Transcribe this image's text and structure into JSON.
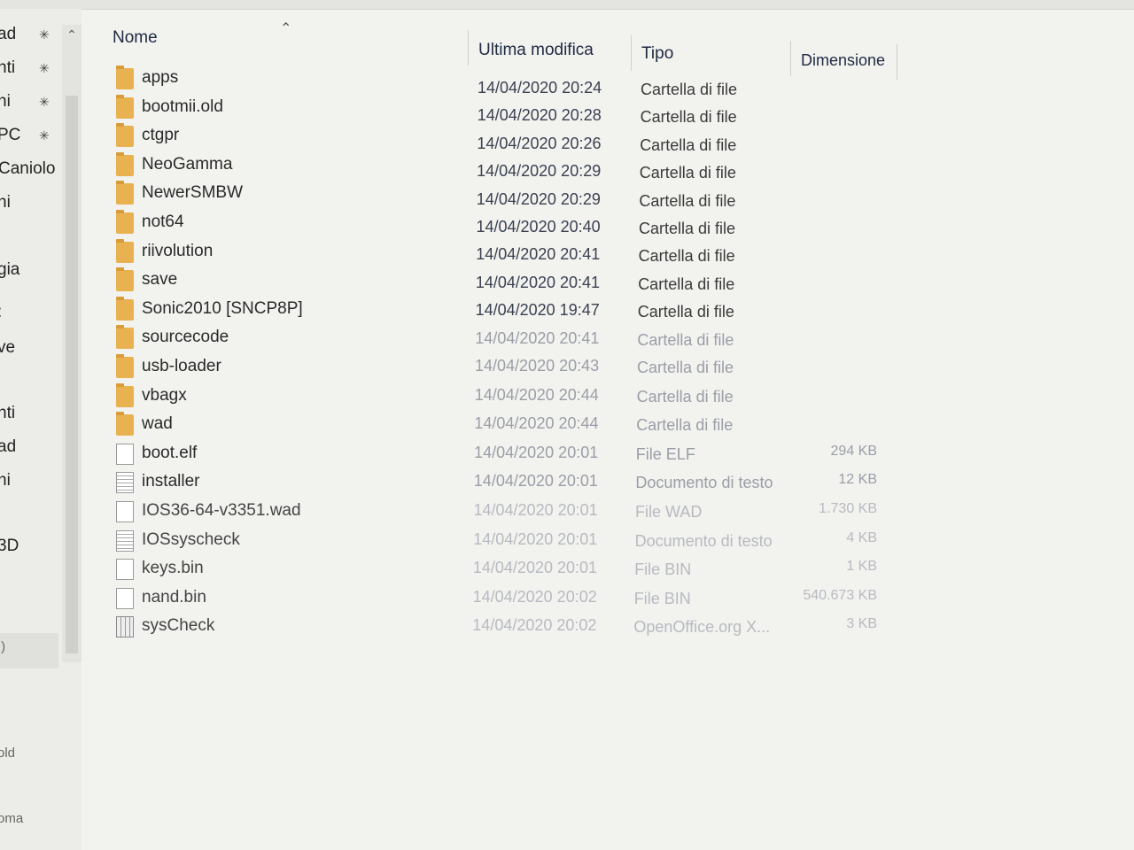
{
  "nav": {
    "items": [
      {
        "label": "ad",
        "pinned": true
      },
      {
        "label": "nti",
        "pinned": true
      },
      {
        "label": "ni",
        "pinned": true
      },
      {
        "label": "PC",
        "pinned": true
      },
      {
        "label": "Caniolo",
        "pinned": false
      },
      {
        "label": "ni",
        "pinned": false
      },
      {
        "label": "gia",
        "pinned": false
      },
      {
        "label": ":",
        "pinned": false
      },
      {
        "label": "ve",
        "pinned": false
      },
      {
        "label": "nti",
        "pinned": false
      },
      {
        "label": "ad",
        "pinned": false
      },
      {
        "label": "ni",
        "pinned": false
      },
      {
        "label": "3D",
        "pinned": false
      },
      {
        "label": ":)",
        "pinned": false
      },
      {
        "label": "old",
        "pinned": false
      },
      {
        "label": "oma",
        "pinned": false
      }
    ],
    "pin_icon": "pin-icon",
    "scroll_up_icon": "chevron-up-icon"
  },
  "columns": {
    "name": "Nome",
    "modified": "Ultima modifica",
    "type": "Tipo",
    "size": "Dimensione",
    "sort_icon": "chevron-up-icon"
  },
  "files": [
    {
      "name": "apps",
      "date": "14/04/2020 20:24",
      "type": "Cartella di file",
      "size": "",
      "icon": "folder-icon"
    },
    {
      "name": "bootmii.old",
      "date": "14/04/2020 20:28",
      "type": "Cartella di file",
      "size": "",
      "icon": "folder-icon"
    },
    {
      "name": "ctgpr",
      "date": "14/04/2020 20:26",
      "type": "Cartella di file",
      "size": "",
      "icon": "folder-icon"
    },
    {
      "name": "NeoGamma",
      "date": "14/04/2020 20:29",
      "type": "Cartella di file",
      "size": "",
      "icon": "folder-icon"
    },
    {
      "name": "NewerSMBW",
      "date": "14/04/2020 20:29",
      "type": "Cartella di file",
      "size": "",
      "icon": "folder-icon"
    },
    {
      "name": "not64",
      "date": "14/04/2020 20:40",
      "type": "Cartella di file",
      "size": "",
      "icon": "folder-icon"
    },
    {
      "name": "riivolution",
      "date": "14/04/2020 20:41",
      "type": "Cartella di file",
      "size": "",
      "icon": "folder-icon"
    },
    {
      "name": "save",
      "date": "14/04/2020 20:41",
      "type": "Cartella di file",
      "size": "",
      "icon": "folder-icon"
    },
    {
      "name": "Sonic2010 [SNCP8P]",
      "date": "14/04/2020 19:47",
      "type": "Cartella di file",
      "size": "",
      "icon": "folder-icon"
    },
    {
      "name": "sourcecode",
      "date": "14/04/2020 20:41",
      "type": "Cartella di file",
      "size": "",
      "icon": "folder-icon"
    },
    {
      "name": "usb-loader",
      "date": "14/04/2020 20:43",
      "type": "Cartella di file",
      "size": "",
      "icon": "folder-icon"
    },
    {
      "name": "vbagx",
      "date": "14/04/2020 20:44",
      "type": "Cartella di file",
      "size": "",
      "icon": "folder-icon"
    },
    {
      "name": "wad",
      "date": "14/04/2020 20:44",
      "type": "Cartella di file",
      "size": "",
      "icon": "folder-icon"
    },
    {
      "name": "boot.elf",
      "date": "14/04/2020 20:01",
      "type": "File ELF",
      "size": "294 KB",
      "icon": "file-icon"
    },
    {
      "name": "installer",
      "date": "14/04/2020 20:01",
      "type": "Documento di testo",
      "size": "12 KB",
      "icon": "text-file-icon"
    },
    {
      "name": "IOS36-64-v3351.wad",
      "date": "14/04/2020 20:01",
      "type": "File WAD",
      "size": "1.730 KB",
      "icon": "file-icon"
    },
    {
      "name": "IOSsyscheck",
      "date": "14/04/2020 20:01",
      "type": "Documento di testo",
      "size": "4 KB",
      "icon": "text-file-icon"
    },
    {
      "name": "keys.bin",
      "date": "14/04/2020 20:01",
      "type": "File BIN",
      "size": "1 KB",
      "icon": "file-icon"
    },
    {
      "name": "nand.bin",
      "date": "14/04/2020 20:02",
      "type": "File BIN",
      "size": "540.673 KB",
      "icon": "file-icon"
    },
    {
      "name": "sysCheck",
      "date": "14/04/2020 20:02",
      "type": "OpenOffice.org X...",
      "size": "3 KB",
      "icon": "spreadsheet-file-icon"
    }
  ]
}
